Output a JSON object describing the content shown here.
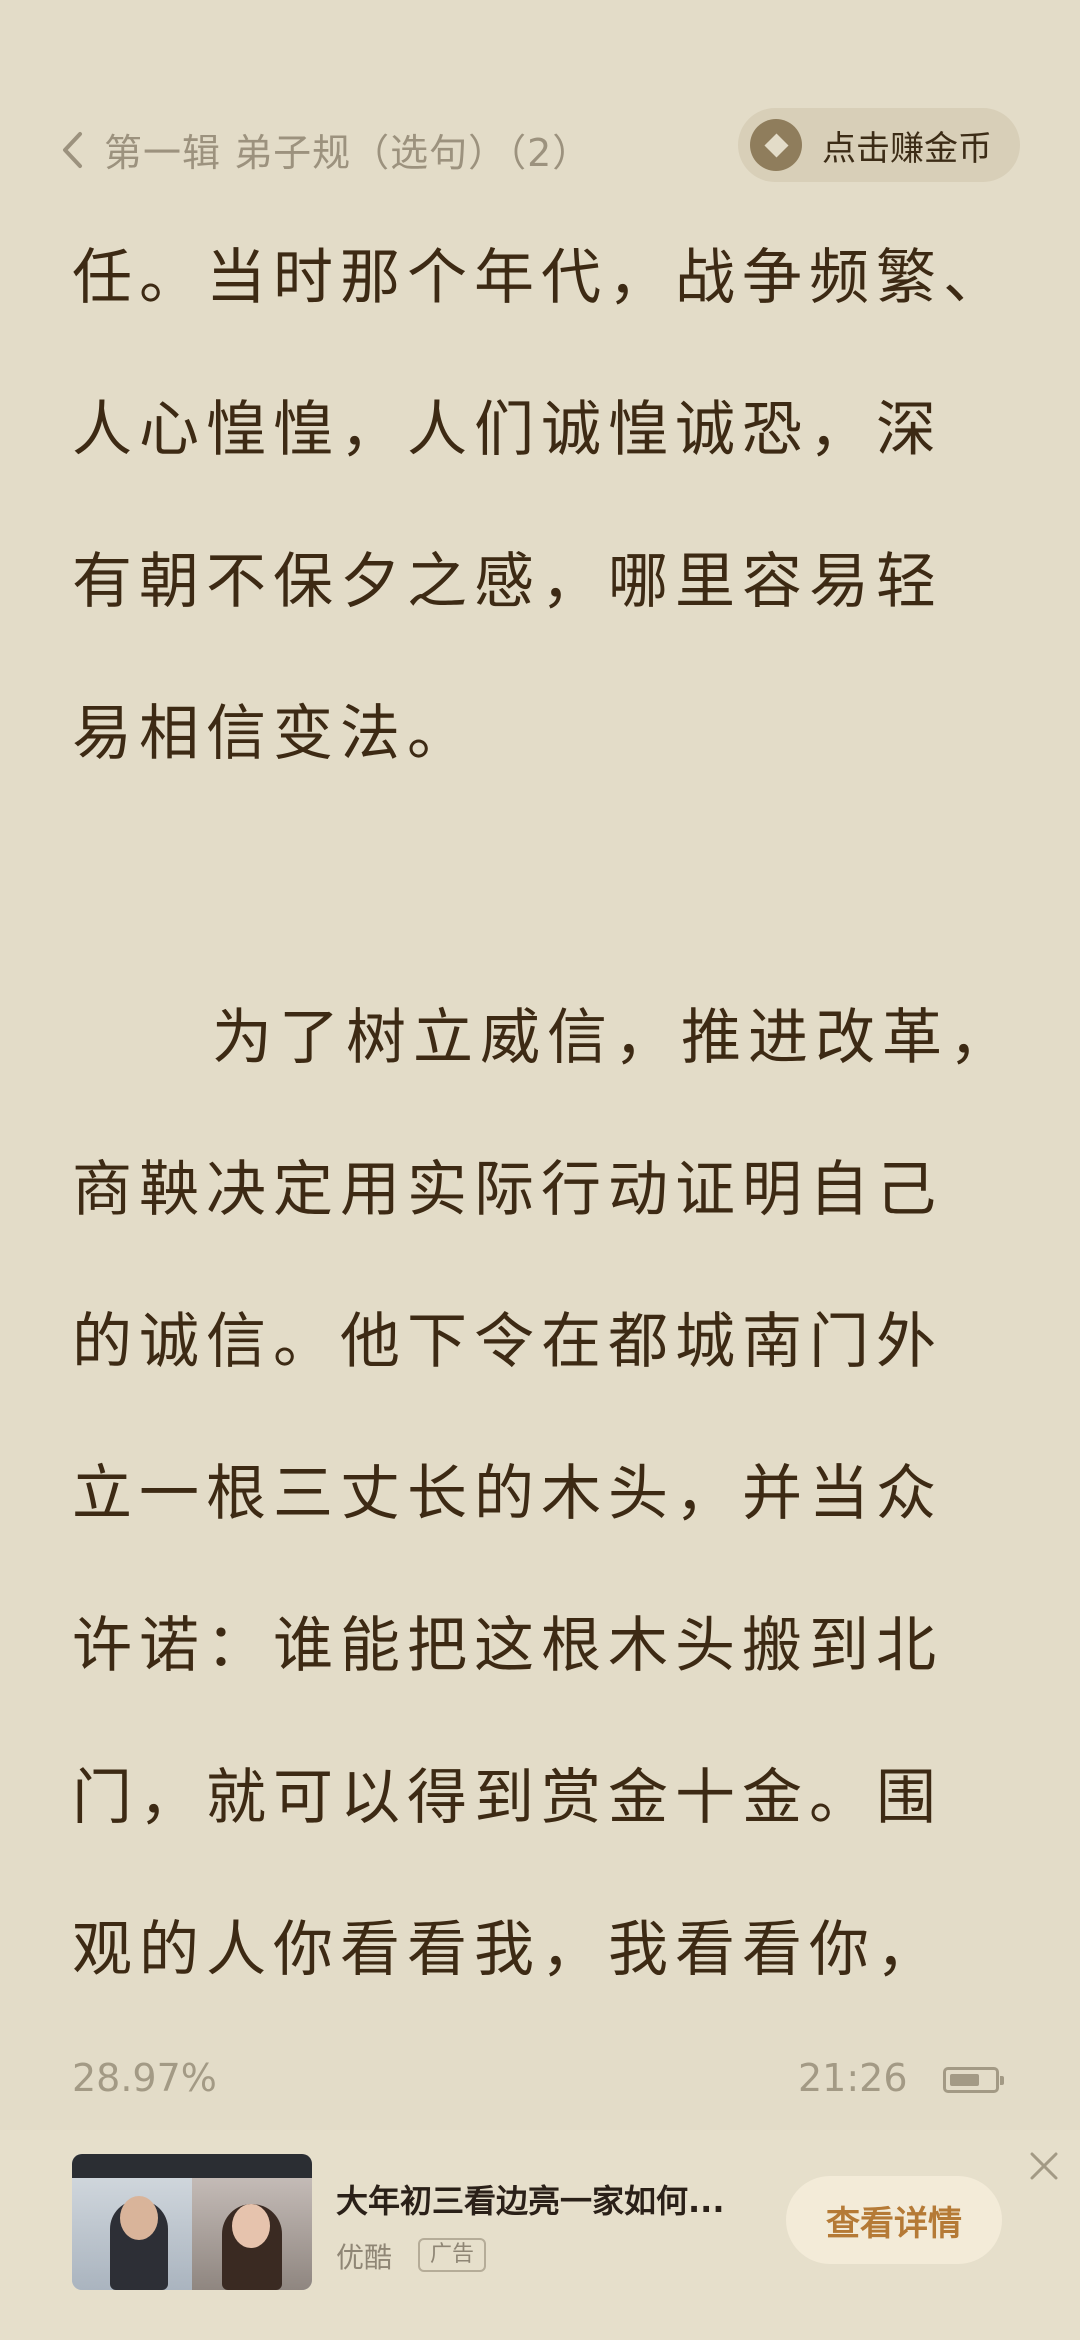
{
  "header": {
    "back_icon": "chevron-left-icon",
    "book_title": "第一辑 弟子规（选句）（2）",
    "coin_button": {
      "icon": "coin-icon",
      "label": "点击赚金币"
    }
  },
  "reader": {
    "lines": [
      "任。当时那个年代，战争频繁、",
      "人心惶惶，人们诚惶诚恐，深",
      "有朝不保夕之感，哪里容易轻",
      "易相信变法。",
      "",
      "为了树立威信，推进改革，",
      "商鞅决定用实际行动证明自己",
      "的诚信。他下令在都城南门外",
      "立一根三丈长的木头，并当众",
      "许诺：谁能把这根木头搬到北",
      "门，就可以得到赏金十金。围",
      "观的人你看看我，我看看你，"
    ]
  },
  "status": {
    "progress": "28.97%",
    "time": "21:26",
    "battery_icon": "battery-icon",
    "battery_level": 0.7
  },
  "ad": {
    "thumbnail": "video-thumbnail",
    "title": "大年初三看边亮一家如何...",
    "brand": "优酷",
    "tag": "广告",
    "cta": "查看详情",
    "close_icon": "close-icon"
  },
  "colors": {
    "background": "#e3dcc8",
    "text": "#3d2a14",
    "muted": "#9c927e",
    "accent": "#b57a36"
  }
}
